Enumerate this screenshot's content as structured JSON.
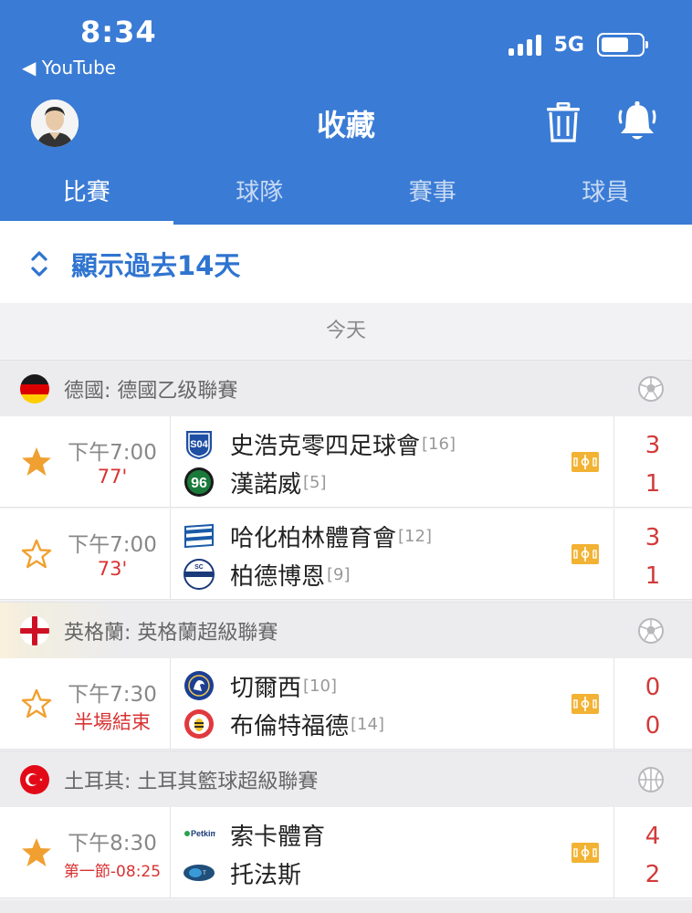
{
  "status_bar": {
    "time": "8:34",
    "back_app": "◀ YouTube",
    "network": "5G",
    "battery_level": 0.68
  },
  "header": {
    "title": "收藏"
  },
  "tabs": [
    {
      "label": "比賽",
      "active": true
    },
    {
      "label": "球隊",
      "active": false
    },
    {
      "label": "賽事",
      "active": false
    },
    {
      "label": "球員",
      "active": false
    }
  ],
  "show_past": {
    "label": "顯示過去14天"
  },
  "day_label": "今天",
  "leagues": [
    {
      "name": "德國: 德國乙级聯賽",
      "sport_icon": "soccer-ball-icon",
      "matches": [
        {
          "starred": true,
          "time": "下午7:00",
          "status": "77'",
          "home": {
            "name": "史浩克零四足球會",
            "rank": "[16]",
            "score": "3"
          },
          "away": {
            "name": "漢諾威",
            "rank": "[5]",
            "score": "1"
          }
        },
        {
          "starred": false,
          "time": "下午7:00",
          "status": "73'",
          "home": {
            "name": "哈化柏林體育會",
            "rank": "[12]",
            "score": "3"
          },
          "away": {
            "name": "柏德博恩",
            "rank": "[9]",
            "score": "1"
          }
        }
      ]
    },
    {
      "name": "英格蘭: 英格蘭超級聯賽",
      "sport_icon": "soccer-ball-icon",
      "matches": [
        {
          "starred": false,
          "time": "下午7:30",
          "status": "半場結束",
          "home": {
            "name": "切爾西",
            "rank": "[10]",
            "score": "0"
          },
          "away": {
            "name": "布倫特福德",
            "rank": "[14]",
            "score": "0"
          }
        }
      ]
    },
    {
      "name": "土耳其: 土耳其籃球超級聯賽",
      "sport_icon": "basketball-icon",
      "matches": [
        {
          "starred": true,
          "time": "下午8:30",
          "status": "第一節-08:25",
          "home": {
            "name": "索卡體育",
            "rank": "",
            "score": "4"
          },
          "away": {
            "name": "托法斯",
            "rank": "",
            "score": "2"
          }
        }
      ]
    }
  ],
  "colors": {
    "header_bg": "#3a7bd5",
    "accent": "#2f74d0",
    "live_red": "#d83232",
    "star_gold": "#f0a030",
    "pitch_gold": "#f2b233"
  },
  "logo_text": {
    "psv_tv_logo": "S04",
    "pinar_logo": "Petkim",
    "paderborn_logo": "SC"
  }
}
